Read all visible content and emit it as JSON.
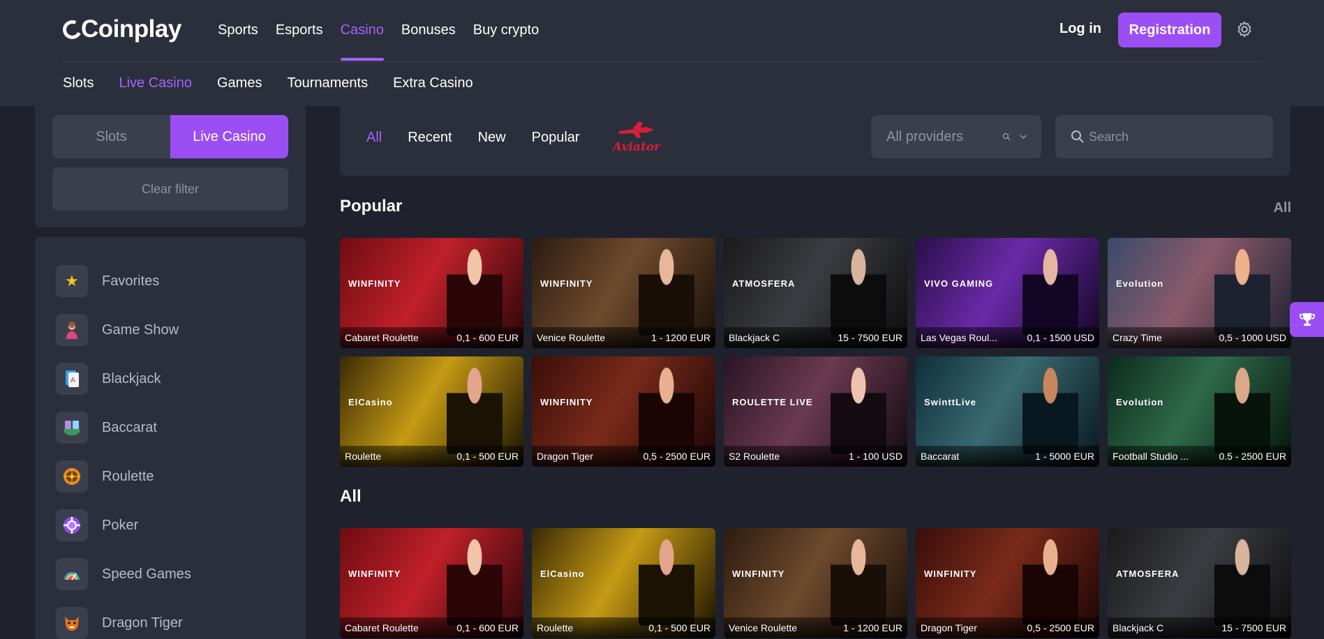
{
  "header": {
    "logo": "Coinplay",
    "nav": [
      "Sports",
      "Esports",
      "Casino",
      "Bonuses",
      "Buy crypto"
    ],
    "nav_active": "Casino",
    "login": "Log in",
    "register": "Registration",
    "subnav": [
      "Slots",
      "Live Casino",
      "Games",
      "Tournaments",
      "Extra Casino"
    ],
    "subnav_active": "Live Casino"
  },
  "sidebar": {
    "segments": [
      "Slots",
      "Live Casino"
    ],
    "segment_active": "Live Casino",
    "clear_filter": "Clear filter",
    "categories": [
      {
        "label": "Favorites",
        "icon": "star-icon"
      },
      {
        "label": "Game Show",
        "icon": "game-show-icon"
      },
      {
        "label": "Blackjack",
        "icon": "blackjack-icon"
      },
      {
        "label": "Baccarat",
        "icon": "baccarat-icon"
      },
      {
        "label": "Roulette",
        "icon": "roulette-icon"
      },
      {
        "label": "Poker",
        "icon": "poker-chip-icon"
      },
      {
        "label": "Speed Games",
        "icon": "speed-icon"
      },
      {
        "label": "Dragon Tiger",
        "icon": "dragon-tiger-icon"
      }
    ]
  },
  "filters": {
    "tabs": [
      "All",
      "Recent",
      "New",
      "Popular"
    ],
    "tab_active": "All",
    "aviator_logo": "Aviator",
    "providers_placeholder": "All providers",
    "search_placeholder": "Search"
  },
  "popular": {
    "title": "Popular",
    "all_link": "All",
    "games": [
      {
        "name": "Cabaret Roulette",
        "range": "0,1 - 600 EUR",
        "brand": "WINFINITY",
        "theme": "red"
      },
      {
        "name": "Venice Roulette",
        "range": "1 - 1200 EUR",
        "brand": "WINFINITY",
        "theme": "brown"
      },
      {
        "name": "Blackjack C",
        "range": "15 - 7500 EUR",
        "brand": "ATMOSFERA",
        "theme": "dark"
      },
      {
        "name": "Las Vegas Roul...",
        "range": "0,1 - 1500 USD",
        "brand": "VIVO GAMING",
        "theme": "purple"
      },
      {
        "name": "Crazy Time",
        "range": "0,5 - 1000 USD",
        "brand": "Evolution",
        "theme": "studio"
      },
      {
        "name": "Roulette",
        "range": "0,1 - 500 EUR",
        "brand": "ElCasino",
        "theme": "gold"
      },
      {
        "name": "Dragon Tiger",
        "range": "0,5 - 2500 EUR",
        "brand": "WINFINITY",
        "theme": "darkred"
      },
      {
        "name": "S2 Roulette",
        "range": "1 - 100 USD",
        "brand": "ROULETTE LIVE",
        "theme": "pinkdark"
      },
      {
        "name": "Baccarat",
        "range": "1 - 5000 EUR",
        "brand": "SwinttLive",
        "theme": "teal"
      },
      {
        "name": "Football Studio ...",
        "range": "0.5 - 2500 EUR",
        "brand": "Evolution",
        "theme": "green"
      }
    ]
  },
  "all": {
    "title": "All",
    "games": [
      {
        "name": "Cabaret Roulette",
        "range": "0,1 - 600 EUR",
        "brand": "WINFINITY",
        "theme": "red"
      },
      {
        "name": "Roulette",
        "range": "0,1 - 500 EUR",
        "brand": "ElCasino",
        "theme": "gold"
      },
      {
        "name": "Venice Roulette",
        "range": "1 - 1200 EUR",
        "brand": "WINFINITY",
        "theme": "brown"
      },
      {
        "name": "Dragon Tiger",
        "range": "0,5 - 2500 EUR",
        "brand": "WINFINITY",
        "theme": "darkred"
      },
      {
        "name": "Blackjack C",
        "range": "15 - 7500 EUR",
        "brand": "ATMOSFERA",
        "theme": "dark"
      }
    ]
  },
  "colors": {
    "accent": "#9c4ef5",
    "background": "#1f222c",
    "panel": "#2b2f3b"
  }
}
